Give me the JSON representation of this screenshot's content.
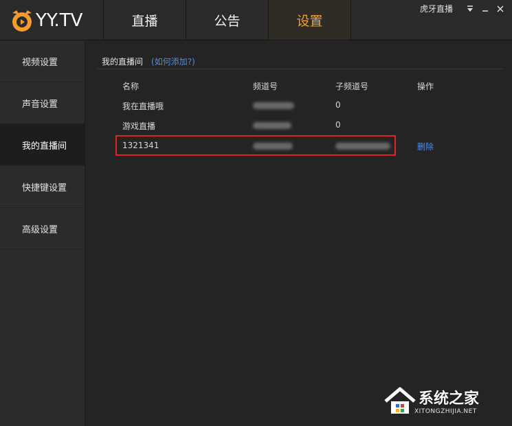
{
  "app": {
    "logo_text": "YY.TV",
    "channel_name": "虎牙直播"
  },
  "nav": {
    "tabs": [
      {
        "label": "直播"
      },
      {
        "label": "公告"
      },
      {
        "label": "设置"
      }
    ],
    "active": "设置"
  },
  "sidebar": {
    "items": [
      {
        "label": "视频设置"
      },
      {
        "label": "声音设置"
      },
      {
        "label": "我的直播间"
      },
      {
        "label": "快捷键设置"
      },
      {
        "label": "高级设置"
      }
    ],
    "active": "我的直播间"
  },
  "main": {
    "section_title": "我的直播间",
    "help_link": "(如何添加?)",
    "columns": [
      "名称",
      "频道号",
      "子频道号",
      "操作"
    ],
    "rows": [
      {
        "name": "我在直播哦",
        "sub_channel": "0",
        "action": ""
      },
      {
        "name": "游戏直播",
        "sub_channel": "0",
        "action": ""
      },
      {
        "name": "1321341",
        "sub_channel": "",
        "action": "删除"
      }
    ]
  },
  "watermark": {
    "brand": "系统之家",
    "url": "XITONGZHIJIA.NET"
  },
  "colors": {
    "accent": "#f2a13c",
    "link": "#4d8ee3",
    "highlight": "#e0252a"
  }
}
